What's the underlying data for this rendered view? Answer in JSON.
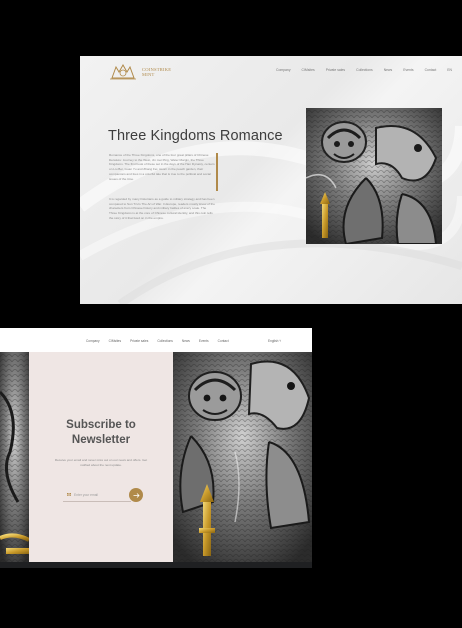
{
  "top": {
    "brand": {
      "line1": "COINSTRIKE",
      "line2": "MINT"
    },
    "nav": [
      "Company",
      "CIMsites",
      "Private sales",
      "Collections",
      "News",
      "Events",
      "Contact",
      "EN"
    ],
    "title": "Three Kingdoms Romance",
    "para1": "Romance of the Three Kingdoms, one of the four great pillars of Chinese literature: Journey to the West, Jin mei Ping, Water Margin, the Three Kingdoms. The first book of these set in the days of the Han Dynasty, centers on Liu Bei, Guan Yu and Zhang Fei, sworn in the peach garden, their companions and foes in a colorful tale that is true to the political and social issues of the time.",
    "para2": "It is regarded by many historians as a guide to military strategy and has been compared to Sun Tzu's The Art of War. In Europe, readers mostly know of the characters from Chinese history and military battles of every scale. The Three Kingdoms is at the core of Chinese cultural identity, and this coin tells the story of it that lived on in the empire.",
    "accent_color": "#b08a4a"
  },
  "bottom": {
    "nav": [
      "Company",
      "CIMsites",
      "Private sales",
      "Collections",
      "News",
      "Events",
      "Contact"
    ],
    "language": "English",
    "title_line1": "Subscribe to",
    "title_line2": "Newsletter",
    "description": "Receive your email and never miss out on our news and offers. Get notified about the next update.",
    "email_placeholder": "Enter your email",
    "submit_icon": "arrow-right-icon",
    "panel_color": "#efe6e4",
    "accent_color": "#b08a4a"
  }
}
